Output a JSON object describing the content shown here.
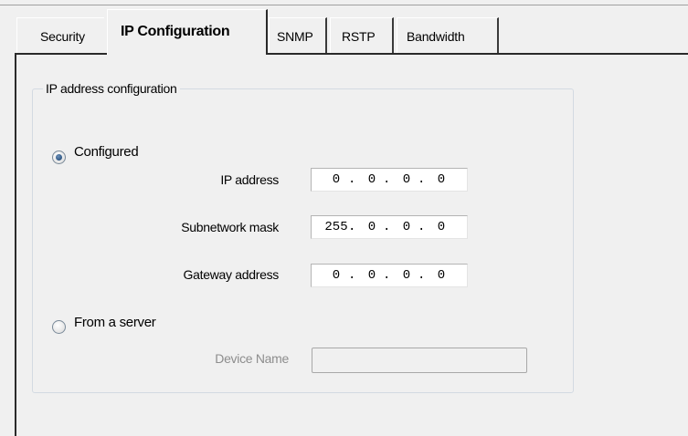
{
  "tabs": [
    {
      "label": "Security",
      "active": false
    },
    {
      "label": "IP Configuration",
      "active": true
    },
    {
      "label": "SNMP",
      "active": false
    },
    {
      "label": "RSTP",
      "active": false
    },
    {
      "label": "Bandwidth",
      "active": false
    }
  ],
  "ip_config": {
    "group_label": "IP address configuration",
    "mode_configured_label": "Configured",
    "mode_server_label": "From a server",
    "selected_mode": "Configured",
    "ip_address": {
      "label": "IP address",
      "octets": [
        "0",
        "0",
        "0",
        "0"
      ]
    },
    "subnet_mask": {
      "label": "Subnetwork mask",
      "octets": [
        "255",
        "0",
        "0",
        "0"
      ]
    },
    "gateway": {
      "label": "Gateway address",
      "octets": [
        "0",
        "0",
        "0",
        "0"
      ]
    },
    "device_name": {
      "label": "Device Name",
      "value": "",
      "enabled": false
    }
  },
  "colors": {
    "background": "#f0f0f0",
    "disabled_text": "#8d8d8d",
    "radio_dot": "#274f7c"
  }
}
